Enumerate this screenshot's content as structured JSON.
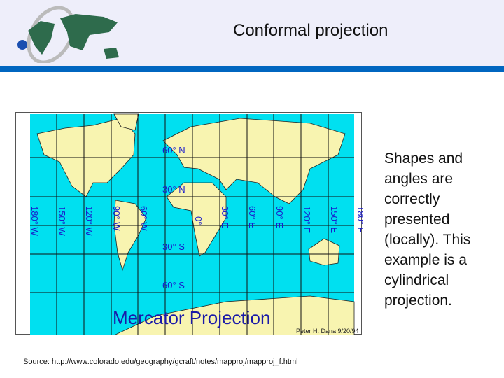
{
  "slide": {
    "title": "Conformal projection",
    "description": "Shapes and angles are correctly presented (locally). This example is a cylindrical projection.",
    "source": "Source: http://www.colorado.edu/geography/gcraft/notes/mapproj/mapproj_f.html"
  },
  "map": {
    "title": "Mercator Projection",
    "credit": "Peter H. Dana 9/20/94",
    "lat_labels": [
      "60° N",
      "30° N",
      "30° S",
      "60° S"
    ],
    "lon_labels": [
      "180° W",
      "150° W",
      "120° W",
      "90° W",
      "60° W",
      "0°",
      "30° E",
      "60° E",
      "90° E",
      "120° E",
      "150° E",
      "180° E"
    ],
    "colors": {
      "ocean": "#00e0f0",
      "land": "#f8f4b0",
      "labels": "#1a1acc"
    }
  }
}
